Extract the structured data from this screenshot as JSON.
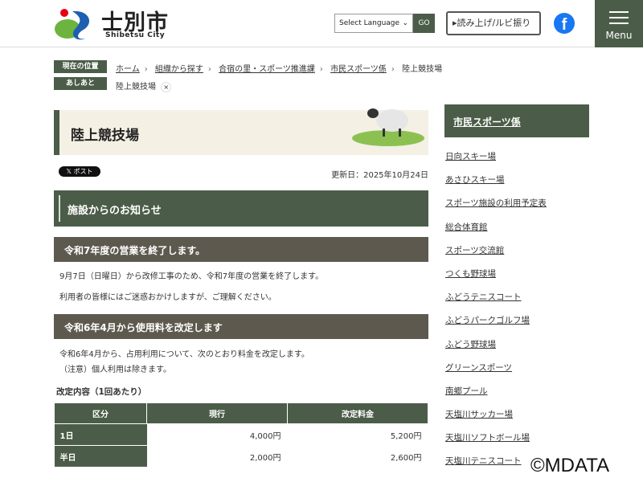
{
  "header": {
    "city_name": "士別市",
    "city_sub": "Shibetsu City",
    "language_select": "Select Language",
    "go_label": "GO",
    "read_aloud_label": "▸読み上げ/ルビ振り",
    "facebook": "f",
    "menu_label": "Menu"
  },
  "breadcrumb": {
    "label": "現在の位置",
    "items": [
      "ホーム",
      "組織から探す",
      "合宿の里・スポーツ推進課",
      "市民スポーツ係"
    ],
    "current": "陸上競技場"
  },
  "footprint": {
    "label": "あしあと",
    "items": [
      "陸上競技場"
    ],
    "close": "×"
  },
  "page": {
    "title": "陸上競技場",
    "x_post": "𝕏 ポスト",
    "updated": "更新日：2025年10月24日"
  },
  "section": {
    "title": "施設からのお知らせ"
  },
  "notices": [
    {
      "heading": "令和7年度の営業を終了します。",
      "paragraphs": [
        "9月7日（日曜日）から改修工事のため、令和7年度の営業を終了します。",
        "利用者の皆様にはご迷惑おかけしますが、ご理解ください。"
      ]
    },
    {
      "heading": "令和6年4月から使用料を改定します",
      "paragraphs": [
        "令和6年4月から、占用利用について、次のとおり料金を改定します。",
        "（注意）個人利用は除きます。"
      ]
    }
  ],
  "fee_table": {
    "caption": "改定内容（1回あたり）",
    "headers": [
      "区分",
      "現行",
      "改定料金"
    ],
    "rows": [
      [
        "1日",
        "4,000円",
        "5,200円"
      ],
      [
        "半日",
        "2,000円",
        "2,600円"
      ]
    ]
  },
  "sidebar": {
    "title": "市民スポーツ係",
    "items": [
      "日向スキー場",
      "あさひスキー場",
      "スポーツ施設の利用予定表",
      "総合体育館",
      "スポーツ交流館",
      "つくも野球場",
      "ふどうテニスコート",
      "ふどうパークゴルフ場",
      "ふどう野球場",
      "グリーンスポーツ",
      "南郷プール",
      "天塩川サッカー場",
      "天塩川ソフトボール場",
      "天塩川テニスコート"
    ]
  },
  "watermark": "©MDATA",
  "colors": {
    "green": "#4b5d48",
    "brown": "#5d594e",
    "beige": "#f4f0e4"
  }
}
